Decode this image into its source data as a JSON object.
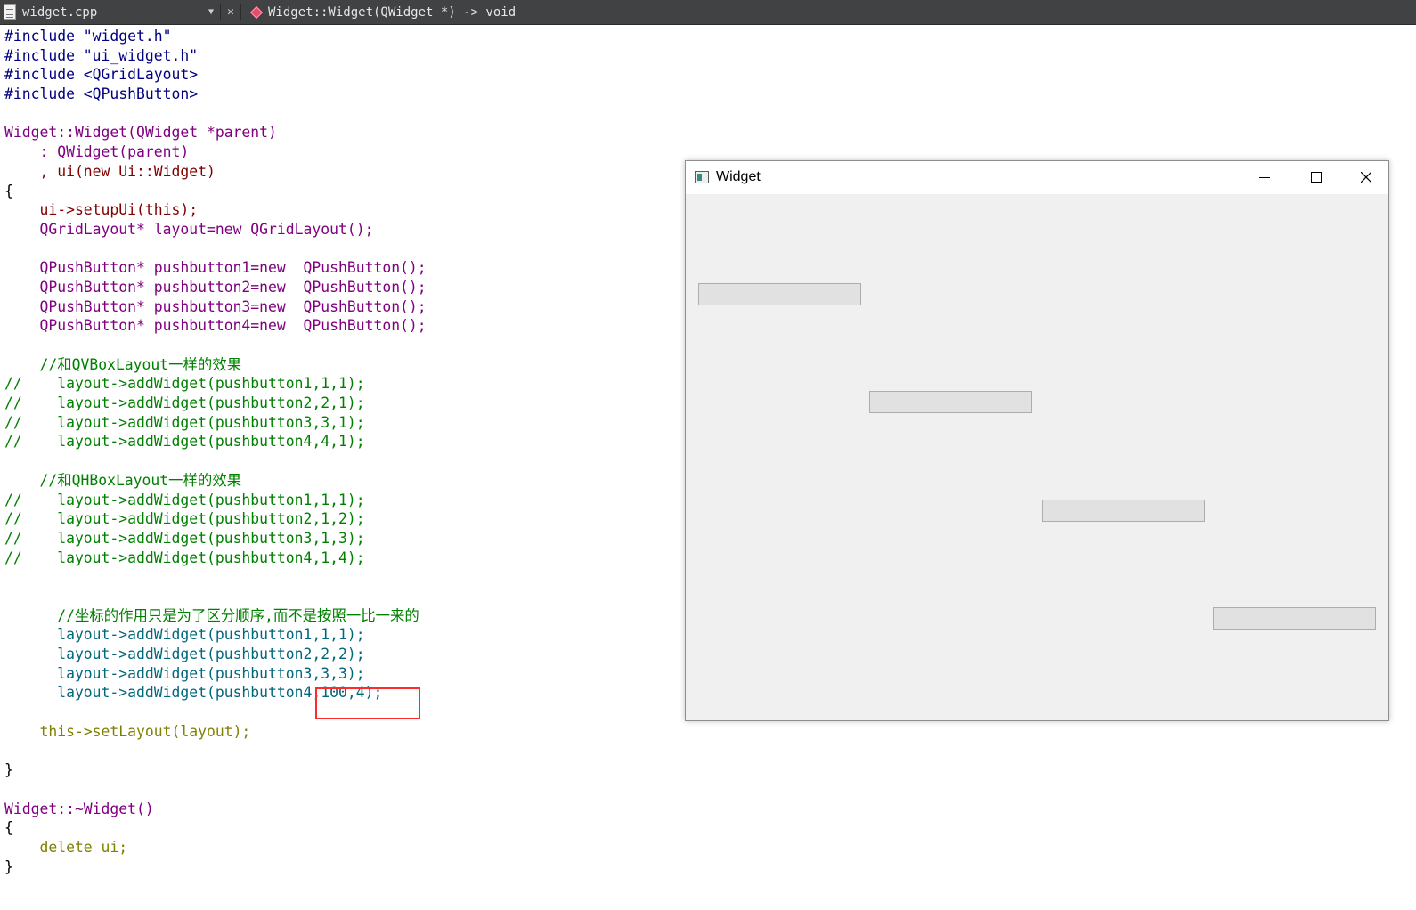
{
  "editor": {
    "file_name": "widget.cpp",
    "symbol": "Widget::Widget(QWidget *) -> void"
  },
  "code_lines": [
    "#include \"widget.h\"",
    "#include \"ui_widget.h\"",
    "#include <QGridLayout>",
    "#include <QPushButton>",
    "",
    "Widget::Widget(QWidget *parent)",
    "    : QWidget(parent)",
    "    , ui(new Ui::Widget)",
    "{",
    "    ui->setupUi(this);",
    "    QGridLayout* layout=new QGridLayout();",
    "",
    "    QPushButton* pushbutton1=new  QPushButton();",
    "    QPushButton* pushbutton2=new  QPushButton();",
    "    QPushButton* pushbutton3=new  QPushButton();",
    "    QPushButton* pushbutton4=new  QPushButton();",
    "",
    "    //和QVBoxLayout一样的效果",
    "//    layout->addWidget(pushbutton1,1,1);",
    "//    layout->addWidget(pushbutton2,2,1);",
    "//    layout->addWidget(pushbutton3,3,1);",
    "//    layout->addWidget(pushbutton4,4,1);",
    "",
    "    //和QHBoxLayout一样的效果",
    "//    layout->addWidget(pushbutton1,1,1);",
    "//    layout->addWidget(pushbutton2,1,2);",
    "//    layout->addWidget(pushbutton3,1,3);",
    "//    layout->addWidget(pushbutton4,1,4);",
    "",
    "",
    "      //坐标的作用只是为了区分顺序,而不是按照一比一来的",
    "      layout->addWidget(pushbutton1,1,1);",
    "      layout->addWidget(pushbutton2,2,2);",
    "      layout->addWidget(pushbutton3,3,3);",
    "      layout->addWidget(pushbutton4,100,4);",
    "",
    "    this->setLayout(layout);",
    "",
    "}",
    "",
    "Widget::~Widget()",
    "{",
    "    delete ui;",
    "}"
  ],
  "window": {
    "title": "Widget",
    "minimize_icon": "minimize-icon",
    "maximize_icon": "maximize-icon",
    "close_icon": "close-icon",
    "buttons": [
      "",
      "",
      "",
      ""
    ]
  },
  "colors": {
    "annotation_border": "#ff2a2a",
    "editor_bar": "#404244",
    "window_background": "#f0f0f0"
  }
}
